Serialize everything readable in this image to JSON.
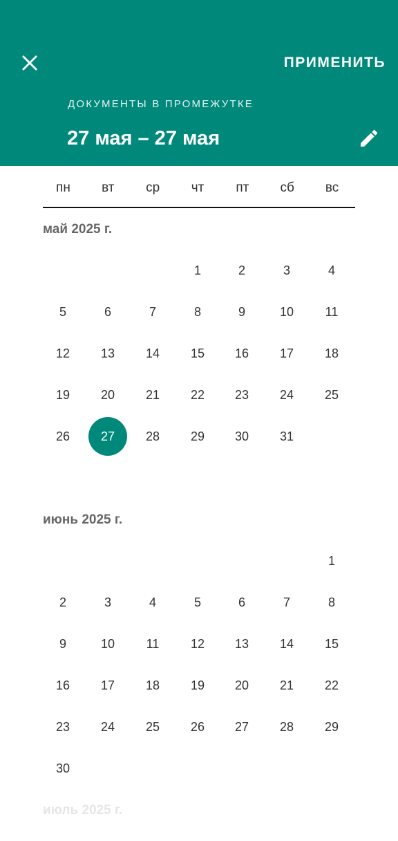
{
  "header": {
    "apply_label": "ПРИМЕНИТЬ",
    "subtitle": "ДОКУМЕНТЫ В ПРОМЕЖУТКЕ",
    "range_text": "27 мая – 27 мая",
    "close_icon": "close-icon",
    "edit_icon": "pencil-icon"
  },
  "colors": {
    "accent": "#00897b",
    "header_text": "#ffffff"
  },
  "weekdays": [
    "пн",
    "вт",
    "ср",
    "чт",
    "пт",
    "сб",
    "вс"
  ],
  "months": [
    {
      "title": "май 2025 г.",
      "first_weekday": 3,
      "days_in_month": 31,
      "selected_day": 27
    },
    {
      "title": "июнь 2025 г.",
      "first_weekday": 6,
      "days_in_month": 30,
      "selected_day": null
    }
  ],
  "next_month_title": "июль 2025 г."
}
